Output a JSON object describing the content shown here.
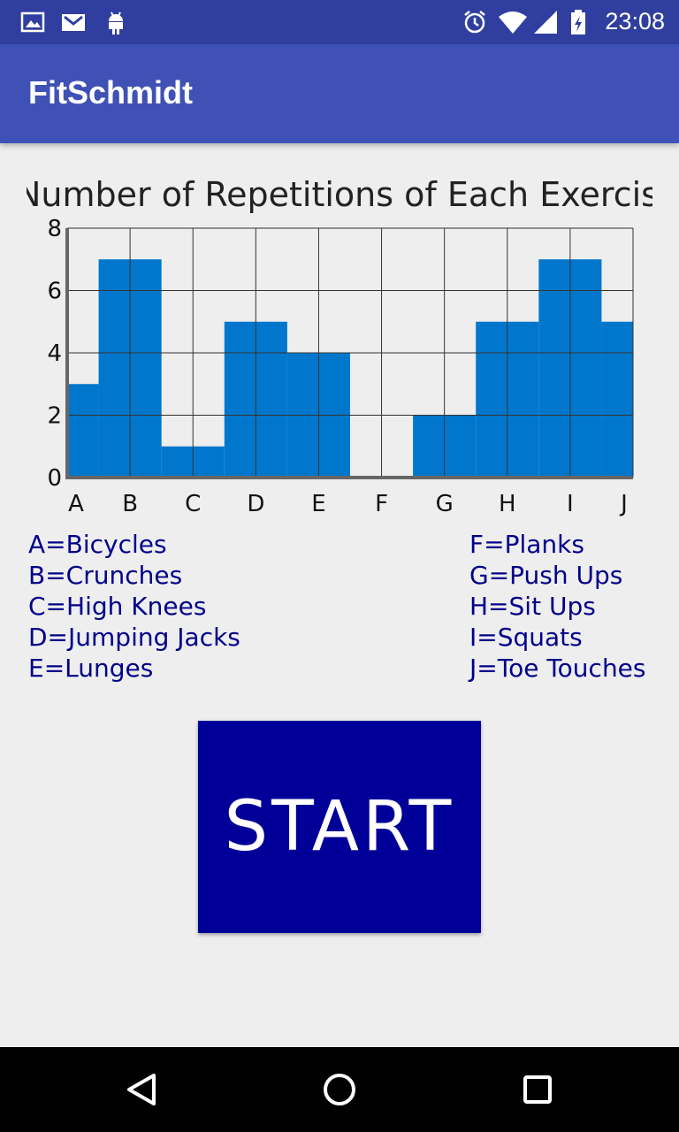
{
  "status_bar": {
    "time": "23:08",
    "left_icons": [
      "image-icon",
      "gmail-icon",
      "android-icon"
    ],
    "right_icons": [
      "alarm-icon",
      "wifi-icon",
      "signal-icon",
      "battery-icon"
    ]
  },
  "app_bar": {
    "title": "FitSchmidt"
  },
  "chart_data": {
    "type": "bar",
    "title": "Number of Repetitions of Each Exercise",
    "categories": [
      "A",
      "B",
      "C",
      "D",
      "E",
      "F",
      "G",
      "H",
      "I",
      "J"
    ],
    "values": [
      3,
      7,
      1,
      5,
      4,
      0,
      2,
      5,
      7,
      5
    ],
    "ylim": [
      0,
      8
    ],
    "yticks": [
      0,
      2,
      4,
      6,
      8
    ],
    "grid": true,
    "bar_color": "#0077cc"
  },
  "legend": {
    "left": [
      "A=Bicycles",
      "B=Crunches",
      "C=High Knees",
      "D=Jumping Jacks",
      "E=Lunges"
    ],
    "right": [
      "F=Planks",
      "G=Push Ups",
      "H=Sit Ups",
      "I=Squats",
      "J=Toe Touches"
    ]
  },
  "start_button": {
    "label": "START"
  },
  "nav_bar": {
    "buttons": [
      "back-icon",
      "home-icon",
      "recents-icon"
    ]
  }
}
